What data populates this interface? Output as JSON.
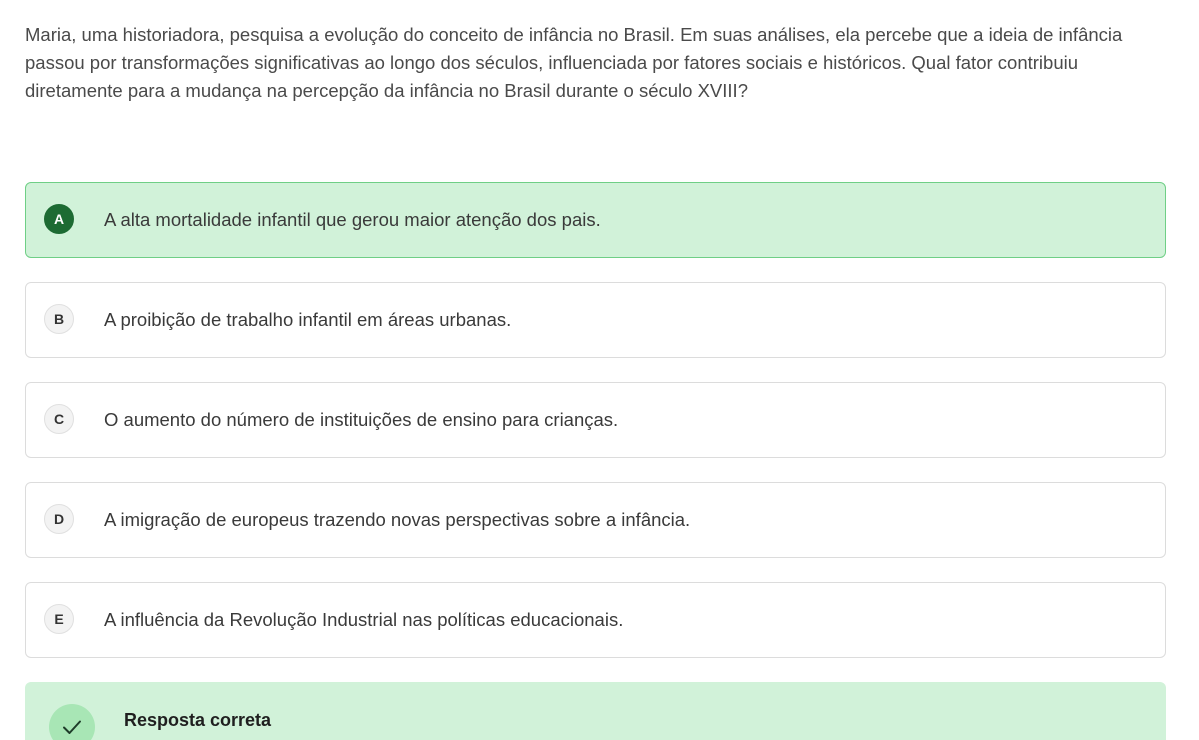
{
  "question": {
    "text": "Maria, uma historiadora, pesquisa a evolução do conceito de infância no Brasil. Em suas análises, ela percebe que a ideia de infância passou por transformações significativas ao longo dos séculos, influenciada por fatores sociais e históricos. Qual fator contribuiu diretamente para a mudança na percepção da infância no Brasil durante o século XVIII?"
  },
  "options": [
    {
      "letter": "A",
      "text": "A alta mortalidade infantil que gerou maior atenção dos pais.",
      "selected": true
    },
    {
      "letter": "B",
      "text": "A proibição de trabalho infantil em áreas urbanas.",
      "selected": false
    },
    {
      "letter": "C",
      "text": "O aumento do número de instituições de ensino para crianças.",
      "selected": false
    },
    {
      "letter": "D",
      "text": "A imigração de europeus trazendo novas perspectivas sobre a infância.",
      "selected": false
    },
    {
      "letter": "E",
      "text": "A influência da Revolução Industrial nas políticas educacionais.",
      "selected": false
    }
  ],
  "feedback": {
    "title": "Resposta correta",
    "icon": "check-icon"
  },
  "colors": {
    "selected_bg": "#d1f2d9",
    "selected_border": "#6fcf86",
    "selected_letter_bg": "#1d6b33",
    "feedback_bg": "#d1f2d9",
    "check_circle": "#a8e6b5"
  }
}
